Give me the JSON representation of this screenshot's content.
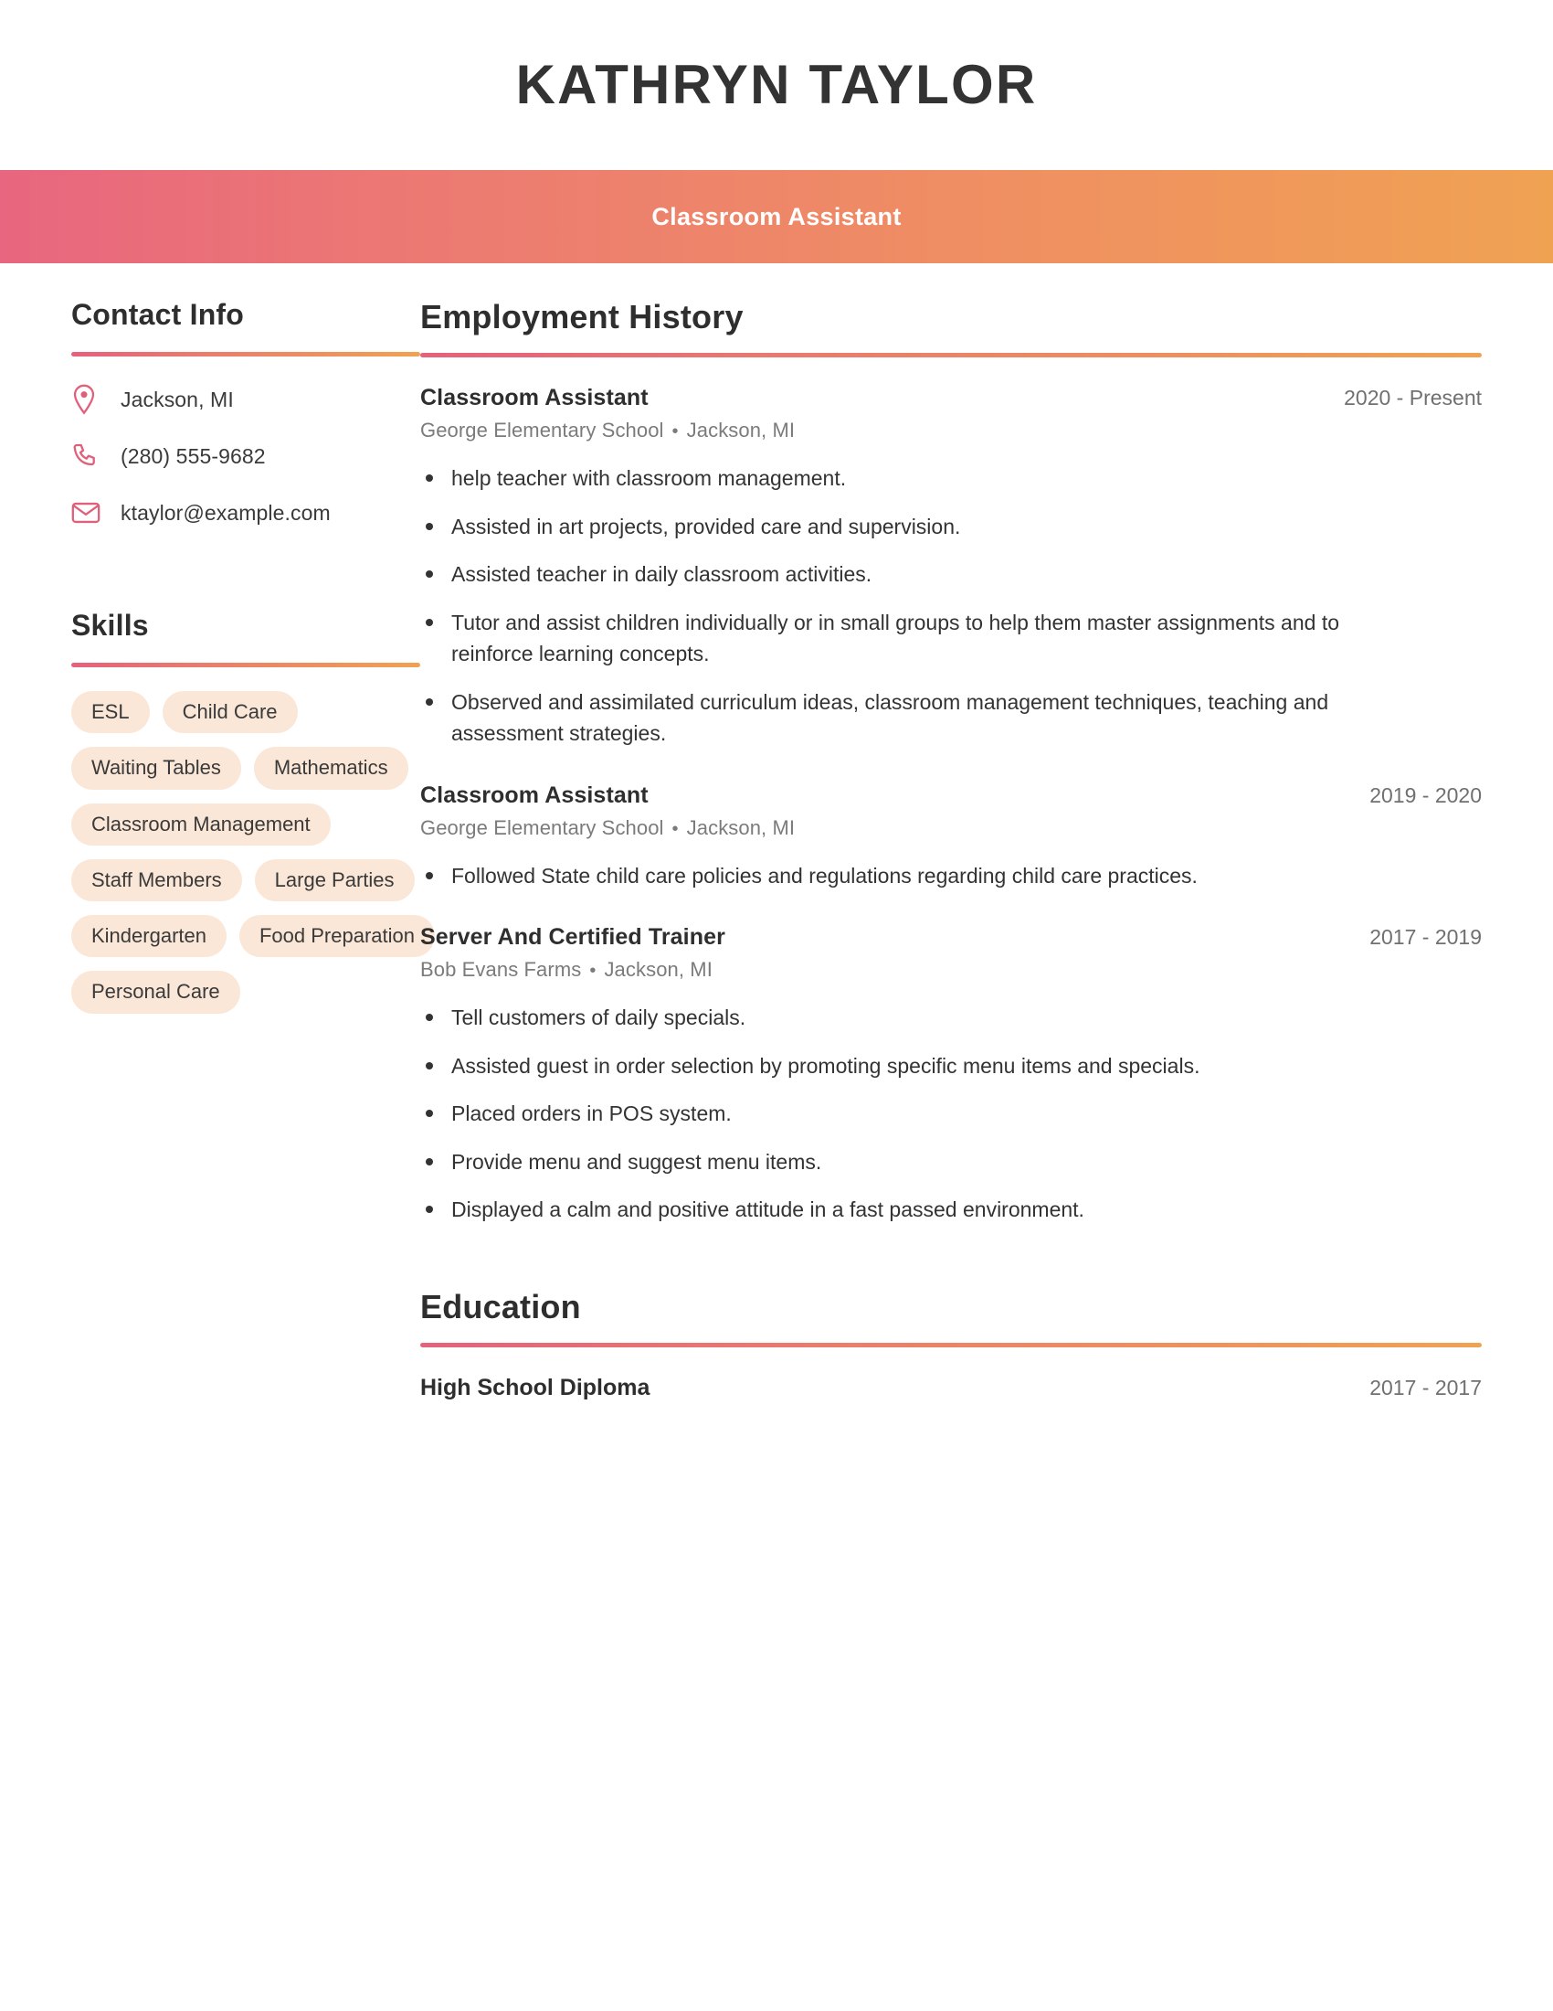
{
  "header": {
    "full_name": "KATHRYN TAYLOR",
    "job_title": "Classroom Assistant"
  },
  "theme": {
    "gradient_start": "#e8667f",
    "gradient_end": "#f0a253",
    "icon_color": "#e0607a",
    "pill_background": "#fbe7d7",
    "text_dark": "#333333",
    "text_muted": "#7b7b7b"
  },
  "sidebar": {
    "contact": {
      "heading": "Contact Info",
      "items": [
        {
          "icon": "location-pin-icon",
          "value": "Jackson, MI"
        },
        {
          "icon": "phone-icon",
          "value": "(280) 555-9682"
        },
        {
          "icon": "envelope-icon",
          "value": "ktaylor@example.com"
        }
      ]
    },
    "skills": {
      "heading": "Skills",
      "items": [
        "ESL",
        "Child Care",
        "Waiting Tables",
        "Mathematics",
        "Classroom Management",
        "Staff Members",
        "Large Parties",
        "Kindergarten",
        "Food Preparation",
        "Personal Care"
      ]
    }
  },
  "main": {
    "employment": {
      "heading": "Employment History",
      "jobs": [
        {
          "position": "Classroom Assistant",
          "dates": "2020 - Present",
          "employer": "George Elementary School",
          "location": "Jackson, MI",
          "bullets": [
            "help teacher with classroom management.",
            "Assisted in art projects, provided care and supervision.",
            "Assisted teacher in daily classroom activities.",
            "Tutor and assist children individually or in small groups to help them master assignments and to reinforce learning concepts.",
            "Observed and assimilated curriculum ideas, classroom management techniques, teaching and assessment strategies."
          ]
        },
        {
          "position": "Classroom Assistant",
          "dates": "2019 - 2020",
          "employer": "George Elementary School",
          "location": "Jackson, MI",
          "bullets": [
            "Followed State child care policies and regulations regarding child care practices."
          ]
        },
        {
          "position": "Server And Certified Trainer",
          "dates": "2017 - 2019",
          "employer": "Bob Evans Farms",
          "location": "Jackson, MI",
          "bullets": [
            "Tell customers of daily specials.",
            "Assisted guest in order selection by promoting specific menu items and specials.",
            "Placed orders in POS system.",
            "Provide menu and suggest menu items.",
            "Displayed a calm and positive attitude in a fast passed environment."
          ]
        }
      ]
    },
    "education": {
      "heading": "Education",
      "entries": [
        {
          "degree": "High School Diploma",
          "dates": "2017 - 2017"
        }
      ]
    }
  }
}
